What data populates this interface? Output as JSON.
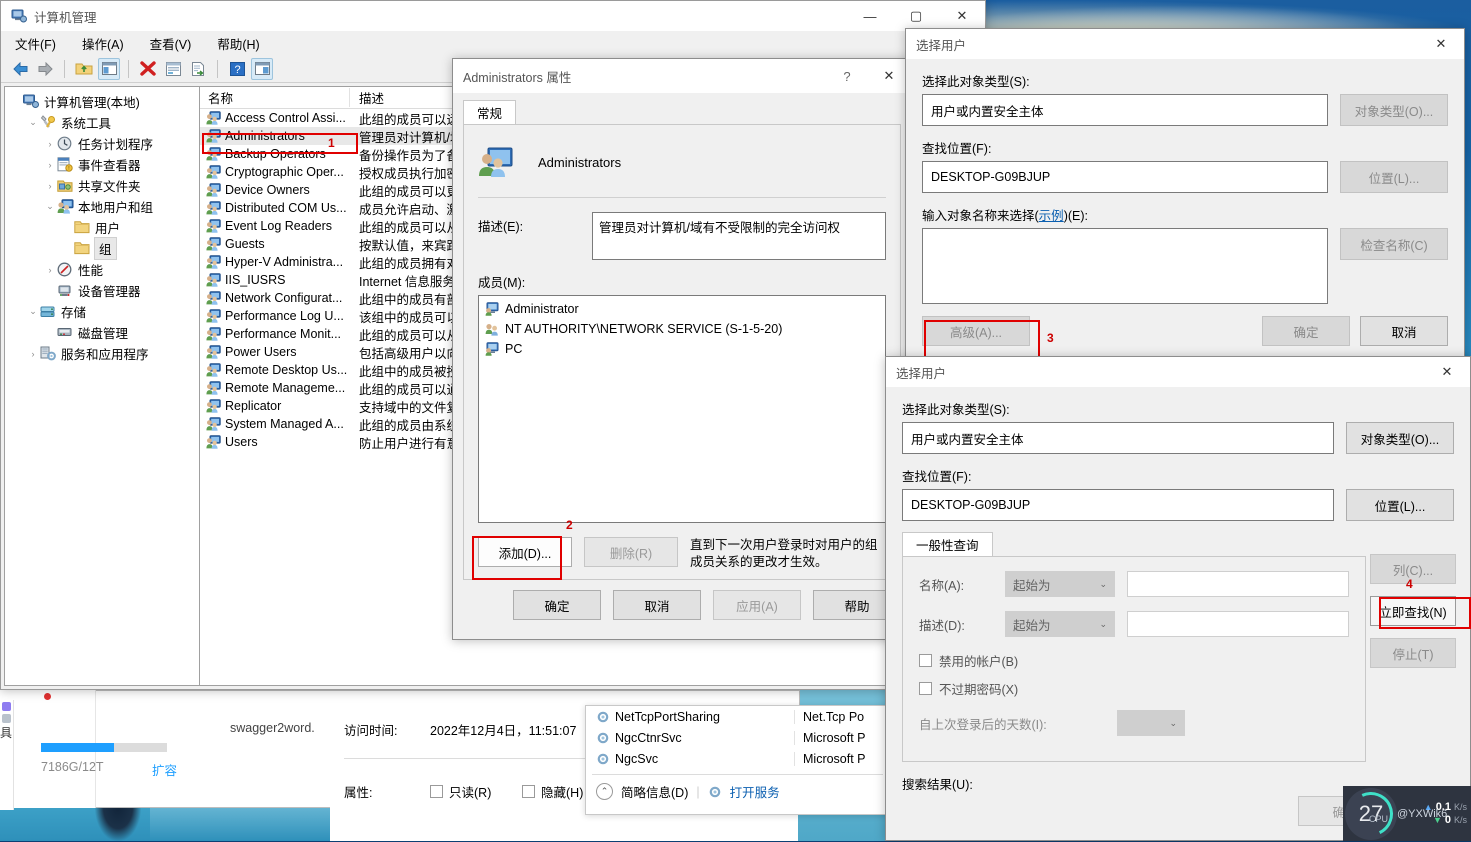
{
  "desktop": {
    "bg_top": "#1b5ea0",
    "bg_bottom": "#4fa8c8"
  },
  "computer_management": {
    "title": "计算机管理",
    "menus": [
      "文件(F)",
      "操作(A)",
      "查看(V)",
      "帮助(H)"
    ],
    "toolbar_icons": [
      "back-arrow-icon",
      "forward-arrow-icon",
      "up-folder-icon",
      "show-hide-tree-icon",
      "delete-icon",
      "properties-icon",
      "export-list-icon",
      "help-icon",
      "show-action-pane-icon"
    ],
    "window_buttons": {
      "minimize": "—",
      "maximize": "▢",
      "close": "✕"
    },
    "tree": [
      {
        "label": "计算机管理(本地)",
        "indent": 0,
        "chevron": "",
        "icon": "computer-icon"
      },
      {
        "label": "系统工具",
        "indent": 1,
        "chevron": "⌄",
        "icon": "tools-icon"
      },
      {
        "label": "任务计划程序",
        "indent": 2,
        "chevron": "›",
        "icon": "clock-icon"
      },
      {
        "label": "事件查看器",
        "indent": 2,
        "chevron": "›",
        "icon": "event-viewer-icon"
      },
      {
        "label": "共享文件夹",
        "indent": 2,
        "chevron": "›",
        "icon": "shared-folder-icon"
      },
      {
        "label": "本地用户和组",
        "indent": 2,
        "chevron": "⌄",
        "icon": "users-groups-icon"
      },
      {
        "label": "用户",
        "indent": 3,
        "chevron": "",
        "icon": "folder-icon"
      },
      {
        "label": "组",
        "indent": 3,
        "chevron": "",
        "icon": "folder-icon",
        "selected": true
      },
      {
        "label": "性能",
        "indent": 2,
        "chevron": "›",
        "icon": "performance-icon"
      },
      {
        "label": "设备管理器",
        "indent": 2,
        "chevron": "",
        "icon": "device-manager-icon"
      },
      {
        "label": "存储",
        "indent": 1,
        "chevron": "⌄",
        "icon": "storage-icon"
      },
      {
        "label": "磁盘管理",
        "indent": 2,
        "chevron": "",
        "icon": "disk-icon"
      },
      {
        "label": "服务和应用程序",
        "indent": 1,
        "chevron": "›",
        "icon": "services-icon"
      }
    ],
    "list_headers": [
      "名称",
      "描述"
    ],
    "groups": [
      {
        "name": "Access Control Assi...",
        "desc": "此组的成员可以远"
      },
      {
        "name": "Administrators",
        "desc": "管理员对计算机/域",
        "selected": true,
        "annotation": "1"
      },
      {
        "name": "Backup Operators",
        "desc": "备份操作员为了备"
      },
      {
        "name": "Cryptographic Oper...",
        "desc": "授权成员执行加密"
      },
      {
        "name": "Device Owners",
        "desc": "此组的成员可以更"
      },
      {
        "name": "Distributed COM Us...",
        "desc": "成员允许启动、激"
      },
      {
        "name": "Event Log Readers",
        "desc": "此组的成员可以从"
      },
      {
        "name": "Guests",
        "desc": "按默认值，来宾跟"
      },
      {
        "name": "Hyper-V Administra...",
        "desc": "此组的成员拥有对"
      },
      {
        "name": "IIS_IUSRS",
        "desc": "Internet 信息服务"
      },
      {
        "name": "Network Configurat...",
        "desc": "此组中的成员有部"
      },
      {
        "name": "Performance Log U...",
        "desc": "该组中的成员可以"
      },
      {
        "name": "Performance Monit...",
        "desc": "此组的成员可以从"
      },
      {
        "name": "Power Users",
        "desc": "包括高级用户以向"
      },
      {
        "name": "Remote Desktop Us...",
        "desc": "此组中的成员被授"
      },
      {
        "name": "Remote Manageme...",
        "desc": "此组的成员可以通"
      },
      {
        "name": "Replicator",
        "desc": "支持域中的文件复"
      },
      {
        "name": "System Managed A...",
        "desc": "此组的成员由系统"
      },
      {
        "name": "Users",
        "desc": "防止用户进行有意"
      }
    ]
  },
  "properties_dialog": {
    "title": "Administrators 属性",
    "help_btn": "?",
    "close_btn": "✕",
    "tab": "常规",
    "group_name": "Administrators",
    "description_label": "描述(E):",
    "description_value": "管理员对计算机/域有不受限制的完全访问权",
    "members_label": "成员(M):",
    "members": [
      {
        "name": "Administrator",
        "icon": "user-icon"
      },
      {
        "name": "NT AUTHORITY\\NETWORK SERVICE (S-1-5-20)",
        "icon": "group-icon"
      },
      {
        "name": "PC",
        "icon": "user-icon"
      }
    ],
    "add_button": "添加(D)...",
    "add_annotation": "2",
    "remove_button": "删除(R)",
    "note": "直到下一次用户登录时对用户的组成员关系的更改才生效。",
    "footer": {
      "ok": "确定",
      "cancel": "取消",
      "apply": "应用(A)",
      "help": "帮助"
    }
  },
  "select_user_1": {
    "title": "选择用户",
    "close_btn": "✕",
    "object_type_label": "选择此对象类型(S):",
    "object_type_value": "用户或内置安全主体",
    "object_type_button": "对象类型(O)...",
    "location_label": "查找位置(F):",
    "location_value": "DESKTOP-G09BJUP",
    "location_button": "位置(L)...",
    "names_label_pre": "输入对象名称来选择(",
    "names_label_link": "示例",
    "names_label_post": ")(E):",
    "names_value": "",
    "check_names_button": "检查名称(C)",
    "advanced_button": "高级(A)...",
    "advanced_annotation": "3",
    "ok_button": "确定",
    "cancel_button": "取消"
  },
  "select_user_2": {
    "title": "选择用户",
    "close_btn": "✕",
    "object_type_label": "选择此对象类型(S):",
    "object_type_value": "用户或内置安全主体",
    "object_type_button": "对象类型(O)...",
    "location_label": "查找位置(F):",
    "location_value": "DESKTOP-G09BJUP",
    "location_button": "位置(L)...",
    "tab": "一般性查询",
    "name_label": "名称(A):",
    "name_op": "起始为",
    "name_value": "",
    "desc_label": "描述(D):",
    "desc_op": "起始为",
    "desc_value": "",
    "chk_disabled": "禁用的帐户(B)",
    "chk_nonexpiring": "不过期密码(X)",
    "days_label": "自上次登录后的天数(I):",
    "days_value": "",
    "columns_button": "列(C)...",
    "find_now_button": "立即查找(N)",
    "find_now_annotation": "4",
    "stop_button": "停止(T)",
    "results_label": "搜索结果(U):",
    "ok_button": "确定"
  },
  "background": {
    "disk_usage": "7186G/12T",
    "expand_link": "扩容",
    "file_name": "swagger2word.",
    "access_time_label": "访问时间:",
    "access_time_value": "2022年12月4日，11:51:07",
    "attributes_label": "属性:",
    "readonly_label": "只读(R)",
    "hidden_label": "隐藏(H)",
    "services": [
      {
        "name": "NetTcpPortSharing",
        "desc": "Net.Tcp Po"
      },
      {
        "name": "NgcCtnrSvc",
        "desc": "Microsoft P"
      },
      {
        "name": "NgcSvc",
        "desc": "Microsoft P"
      }
    ],
    "brief_info": "简略信息(D)",
    "open_service": "打开服务"
  },
  "net_speed": {
    "cpu_value": "27",
    "cpu_unit": "CPU",
    "upload_value": "0.1",
    "upload_unit": "K/s",
    "download_value": "0",
    "download_unit": "K/s",
    "brand": "@YXWik6"
  }
}
